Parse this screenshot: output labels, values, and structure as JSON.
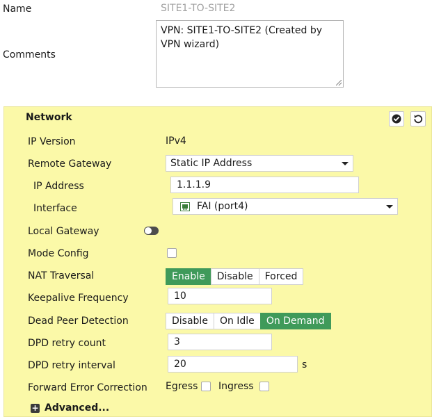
{
  "form": {
    "name_label": "Name",
    "name_value": "SITE1-TO-SITE2",
    "comments_label": "Comments",
    "comments_value": "VPN: SITE1-TO-SITE2 (Created by VPN wizard)"
  },
  "network": {
    "title": "Network",
    "ip_version_label": "IP Version",
    "ip_version_value": "IPv4",
    "remote_gateway_label": "Remote Gateway",
    "remote_gateway_value": "Static IP Address",
    "ip_address_label": "IP Address",
    "ip_address_value": "1.1.1.9",
    "interface_label": "Interface",
    "interface_value": "FAI (port4)",
    "local_gateway_label": "Local Gateway",
    "local_gateway_enabled": false,
    "mode_config_label": "Mode Config",
    "mode_config_checked": false,
    "nat_traversal_label": "NAT Traversal",
    "nat_traversal_options": [
      "Enable",
      "Disable",
      "Forced"
    ],
    "nat_traversal_selected": "Enable",
    "keepalive_label": "Keepalive Frequency",
    "keepalive_value": "10",
    "dpd_label": "Dead Peer Detection",
    "dpd_options": [
      "Disable",
      "On Idle",
      "On Demand"
    ],
    "dpd_selected": "On Demand",
    "dpd_retry_count_label": "DPD retry count",
    "dpd_retry_count_value": "3",
    "dpd_retry_interval_label": "DPD retry interval",
    "dpd_retry_interval_value": "20",
    "dpd_retry_interval_unit": "s",
    "fec_label": "Forward Error Correction",
    "fec_egress_label": "Egress",
    "fec_egress_checked": false,
    "fec_ingress_label": "Ingress",
    "fec_ingress_checked": false,
    "advanced_label": "Advanced..."
  },
  "colors": {
    "panel_bg": "#fbf9a8",
    "active_green": "#3f9a5a"
  },
  "icons": {
    "apply": "check-circle-icon",
    "revert": "undo-icon",
    "interface": "network-port-icon",
    "advanced": "plus-square-icon"
  }
}
